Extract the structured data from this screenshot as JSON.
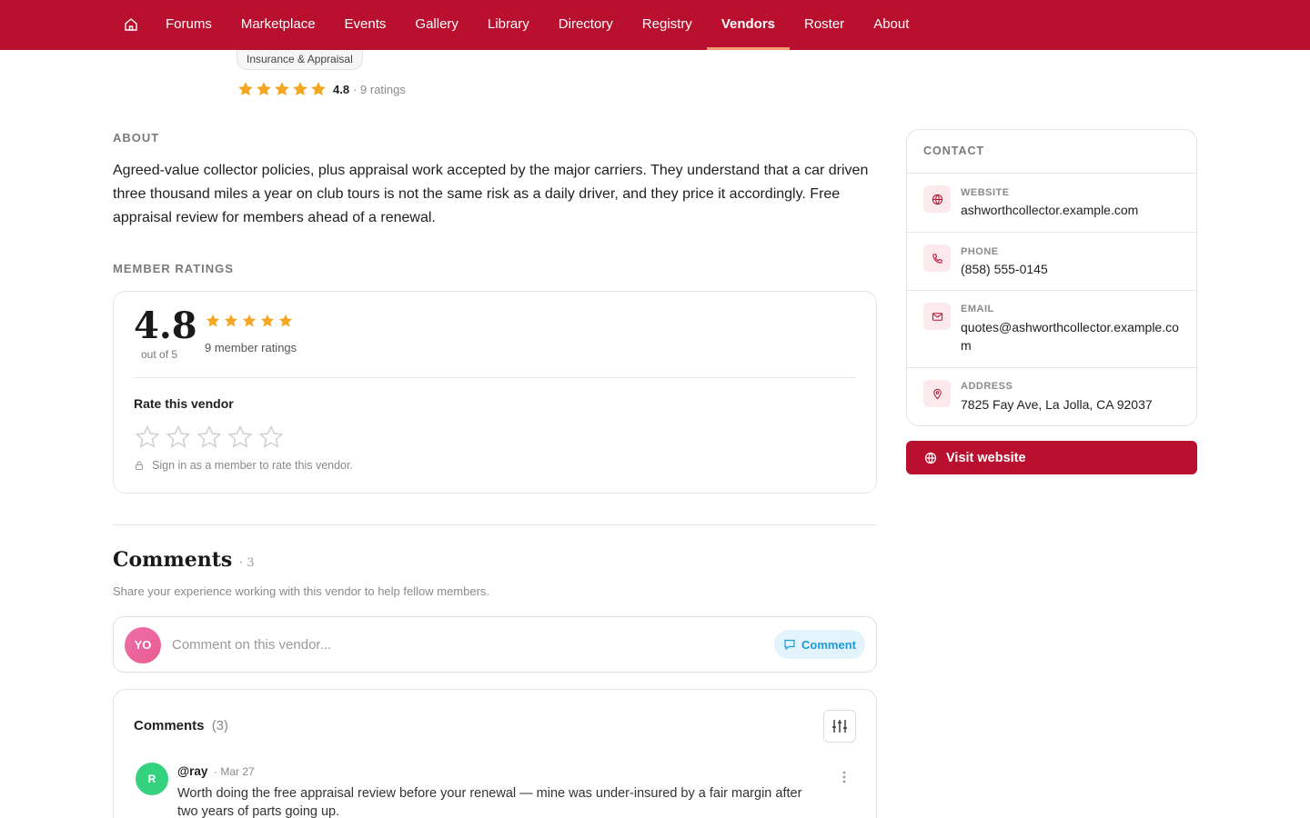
{
  "nav": {
    "home_icon": "home-icon",
    "items": [
      {
        "label": "Forums"
      },
      {
        "label": "Marketplace"
      },
      {
        "label": "Events"
      },
      {
        "label": "Gallery"
      },
      {
        "label": "Library"
      },
      {
        "label": "Directory"
      },
      {
        "label": "Registry"
      },
      {
        "label": "Vendors",
        "active": true
      },
      {
        "label": "Roster"
      },
      {
        "label": "About"
      }
    ]
  },
  "vendor": {
    "category": "Insurance & Appraisal",
    "rating": "4.8",
    "ratings_count": "· 9 ratings",
    "rating_value": 4.8,
    "rating_max": 5
  },
  "about": {
    "label": "ABOUT",
    "text": "Agreed-value collector policies, plus appraisal work accepted by the major carriers. They understand that a car driven three thousand miles a year on club tours is not the same risk as a daily driver, and they price it accordingly. Free appraisal review for members ahead of a renewal."
  },
  "member_ratings": {
    "label": "MEMBER RATINGS",
    "score": "4.8",
    "out_of": "out of 5",
    "count_text": "9 member ratings",
    "rate_title": "Rate this vendor",
    "signin_note": "Sign in as a member to rate this vendor."
  },
  "comments": {
    "heading": "Comments",
    "heading_count": "· 3",
    "subtitle": "Share your experience working with this vendor to help fellow members.",
    "composer": {
      "avatar": "YO",
      "placeholder": "Comment on this vendor...",
      "button": "Comment"
    },
    "list_title": "Comments",
    "list_count": "(3)",
    "items": [
      {
        "avatar": "R",
        "author": "@ray",
        "date": "· Mar 27",
        "text": "Worth doing the free appraisal review before your renewal — mine was under-insured by a fair margin after two years of parts going up."
      }
    ]
  },
  "contact": {
    "title": "CONTACT",
    "rows": [
      {
        "label": "WEBSITE",
        "value": "ashworthcollector.example.com",
        "icon": "globe-icon"
      },
      {
        "label": "PHONE",
        "value": "(858) 555-0145",
        "icon": "phone-icon"
      },
      {
        "label": "EMAIL",
        "value": "quotes@ashworthcollector.example.com",
        "icon": "mail-icon"
      },
      {
        "label": "ADDRESS",
        "value": "7825 Fay Ave, La Jolla, CA 92037",
        "icon": "map-pin-icon"
      }
    ],
    "visit_button": "Visit website"
  },
  "colors": {
    "brand": "#b8102e",
    "star": "#f5a623",
    "comment_accent": "#1c9ad6"
  }
}
